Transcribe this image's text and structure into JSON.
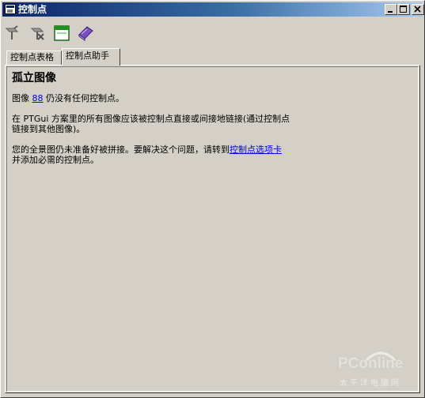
{
  "window": {
    "title": "控制点",
    "buttons": [
      "minimize",
      "maximize",
      "close"
    ]
  },
  "toolbar": {
    "icons": [
      "pin-tool-icon",
      "pin-remove-icon",
      "window-icon",
      "book-icon"
    ]
  },
  "tabs": [
    {
      "label": "控制点表格",
      "active": false
    },
    {
      "label": "控制点助手",
      "active": true
    }
  ],
  "content": {
    "heading": "孤立图像",
    "line1_before": "图像 ",
    "line1_link": "88",
    "line1_after": " 仍没有任何控制点。",
    "line2a": "在 PTGui 方案里的所有图像应该被控制点直接或间接地链接(通过控制点",
    "line2b": "链接到其他图像)。",
    "line3_before": "您的全景图仍未准备好被拼接。要解决这个问题，请转到",
    "line3_link": "控制点选项卡",
    "line3b": "并添加必需的控制点。"
  },
  "watermark": {
    "logo": "PConline",
    "subtitle": "太平洋电脑网"
  },
  "colors": {
    "titlebar_start": "#0a246a",
    "titlebar_end": "#a6caf0",
    "face": "#d4d0c8",
    "link": "#0000ee"
  }
}
